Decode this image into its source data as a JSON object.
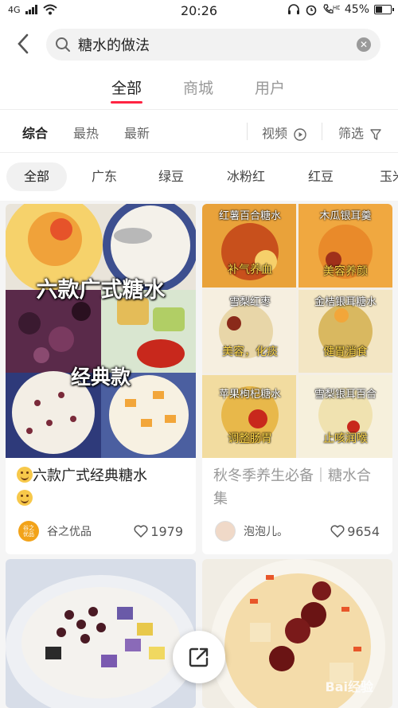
{
  "status_bar": {
    "network": "4G",
    "time": "20:26",
    "battery": "45%",
    "battery_level": 0.45
  },
  "search": {
    "query": "糖水的做法",
    "clear_icon": "close-circle-icon"
  },
  "tabs": [
    {
      "label": "全部",
      "active": true
    },
    {
      "label": "商城",
      "active": false
    },
    {
      "label": "用户",
      "active": false
    }
  ],
  "sort": {
    "comprehensive": "综合",
    "hottest": "最热",
    "newest": "最新",
    "video": "视频",
    "filter": "筛选"
  },
  "chips": [
    "全部",
    "广东",
    "绿豆",
    "冰粉红",
    "红豆",
    "玉米"
  ],
  "cards": [
    {
      "title": "六款广式经典糖水",
      "overlay_title": "六款广式糖水",
      "overlay_sub": "经典款",
      "author": "谷之优品",
      "avatar_text": "谷之优品",
      "likes": "1979"
    },
    {
      "title": "秋冬季养生必备｜糖水合集",
      "author": "泡泡儿。",
      "likes": "9654",
      "grid_labels": [
        {
          "name": "红薯百合糖水",
          "effect": "补气养血"
        },
        {
          "name": "木瓜银耳羹",
          "effect": "美容养颜"
        },
        {
          "name": "雪梨红枣",
          "effect": "美容，化痰"
        },
        {
          "name": "金桔银耳糖水",
          "effect": "健胃消食"
        },
        {
          "name": "苹果枸杞糖水",
          "effect": "调整肠胃"
        },
        {
          "name": "雪梨银耳百合",
          "effect": "止咳润喉"
        }
      ]
    }
  ],
  "watermark": "Bai经验",
  "colors": {
    "accent": "#ff2442",
    "label_yellow": "#ffd84a"
  }
}
